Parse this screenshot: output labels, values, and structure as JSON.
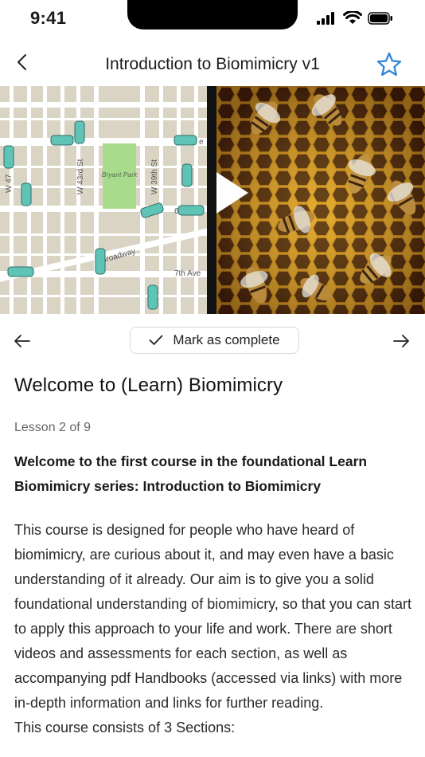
{
  "status_bar": {
    "time": "9:41"
  },
  "nav": {
    "title": "Introduction to Biomimicry v1",
    "back_icon": "chevron-left-icon",
    "favorite_icon": "star-outline-icon",
    "accent_color": "#2f86d6"
  },
  "media": {
    "map_labels": {
      "park": "Bryant Park",
      "street_47": "W 47",
      "street_43": "W 43rd St",
      "street_39": "W 39th St",
      "broadway": "Broadway",
      "seventh_ave": "7th Ave",
      "e_label": "e",
      "six_label": "6"
    },
    "play_icon": "play-icon"
  },
  "lesson_controls": {
    "prev_icon": "arrow-left-icon",
    "next_icon": "arrow-right-icon",
    "complete_label": "Mark as complete"
  },
  "content": {
    "heading": "Welcome to (Learn) Biomimicry",
    "lesson_counter": "Lesson 2 of 9",
    "lead": "Welcome to the first course in the foundational Learn Biomimicry series: Introduction to Biomimicry",
    "body": "This course is designed for people who have heard of biomimicry, are curious about it, and may even have a basic understanding of it already. Our aim is to give you a solid foundational understanding of biomimicry, so that you can start to apply this approach to your life and work. There are short videos and assessments for each section, as well as accompanying pdf Handbooks (accessed via links) with more in-depth information and links for further reading.",
    "body_next": "This course consists of 3 Sections:"
  }
}
